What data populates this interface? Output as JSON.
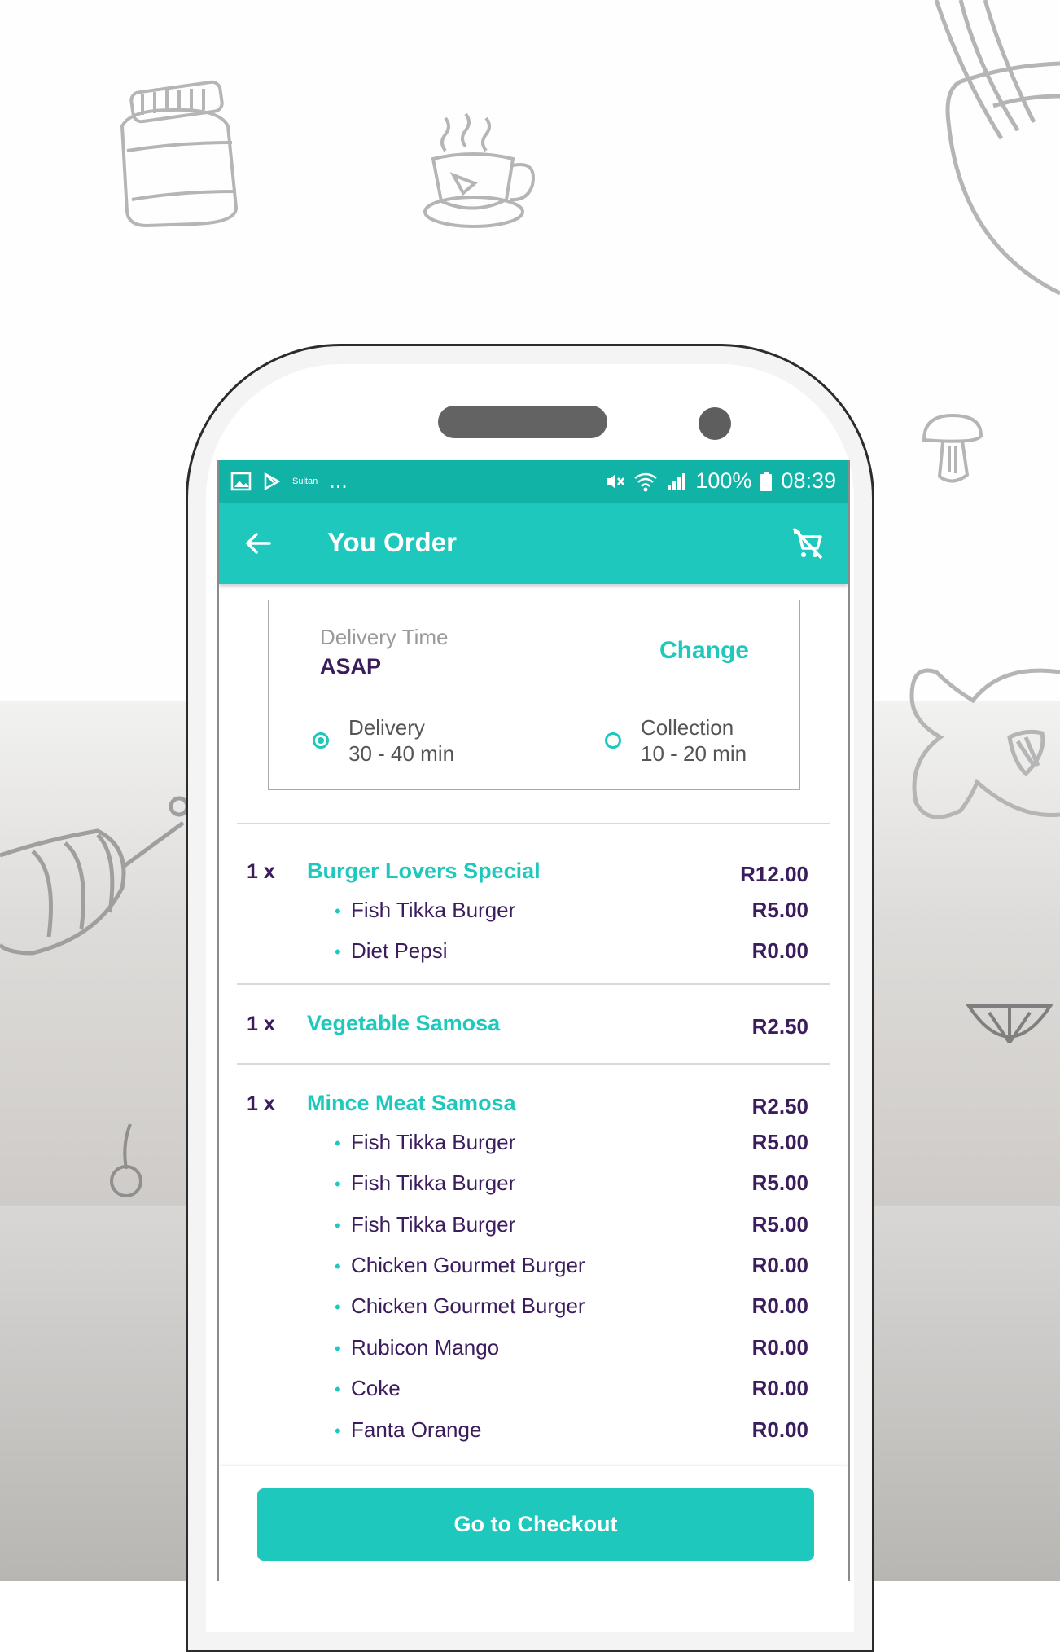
{
  "status_bar": {
    "tiny_text": "Sultan",
    "dots": "...",
    "battery": "100%",
    "time": "08:39"
  },
  "app_bar": {
    "title": "You Order",
    "back_icon": "arrow-left-icon",
    "clear_cart_icon": "cart-remove-icon"
  },
  "delivery_card": {
    "label": "Delivery Time",
    "value": "ASAP",
    "change_label": "Change",
    "options": [
      {
        "name": "Delivery",
        "time": "30 - 40 min",
        "selected": true
      },
      {
        "name": "Collection",
        "time": "10 - 20 min",
        "selected": false
      }
    ]
  },
  "order": {
    "items": [
      {
        "qty": "1 x",
        "name": "Burger Lovers Special",
        "price": "R12.00",
        "extras": [
          {
            "name": "Fish Tikka Burger",
            "price": "R5.00"
          },
          {
            "name": "Diet Pepsi",
            "price": "R0.00"
          }
        ]
      },
      {
        "qty": "1 x",
        "name": "Vegetable Samosa",
        "price": "R2.50",
        "extras": []
      },
      {
        "qty": "1 x",
        "name": "Mince Meat Samosa",
        "price": "R2.50",
        "extras": [
          {
            "name": "Fish Tikka Burger",
            "price": "R5.00"
          },
          {
            "name": "Fish Tikka Burger",
            "price": "R5.00"
          },
          {
            "name": "Fish Tikka Burger",
            "price": "R5.00"
          },
          {
            "name": "Chicken Gourmet Burger",
            "price": "R0.00"
          },
          {
            "name": "Chicken Gourmet Burger",
            "price": "R0.00"
          },
          {
            "name": "Rubicon Mango",
            "price": "R0.00"
          },
          {
            "name": "Coke",
            "price": "R0.00"
          },
          {
            "name": "Fanta Orange",
            "price": "R0.00"
          }
        ]
      }
    ]
  },
  "checkout_label": "Go to Checkout",
  "colors": {
    "accent": "#1ec8bc",
    "status_bar": "#12b3a7",
    "text_dark": "#3b1d5e"
  }
}
